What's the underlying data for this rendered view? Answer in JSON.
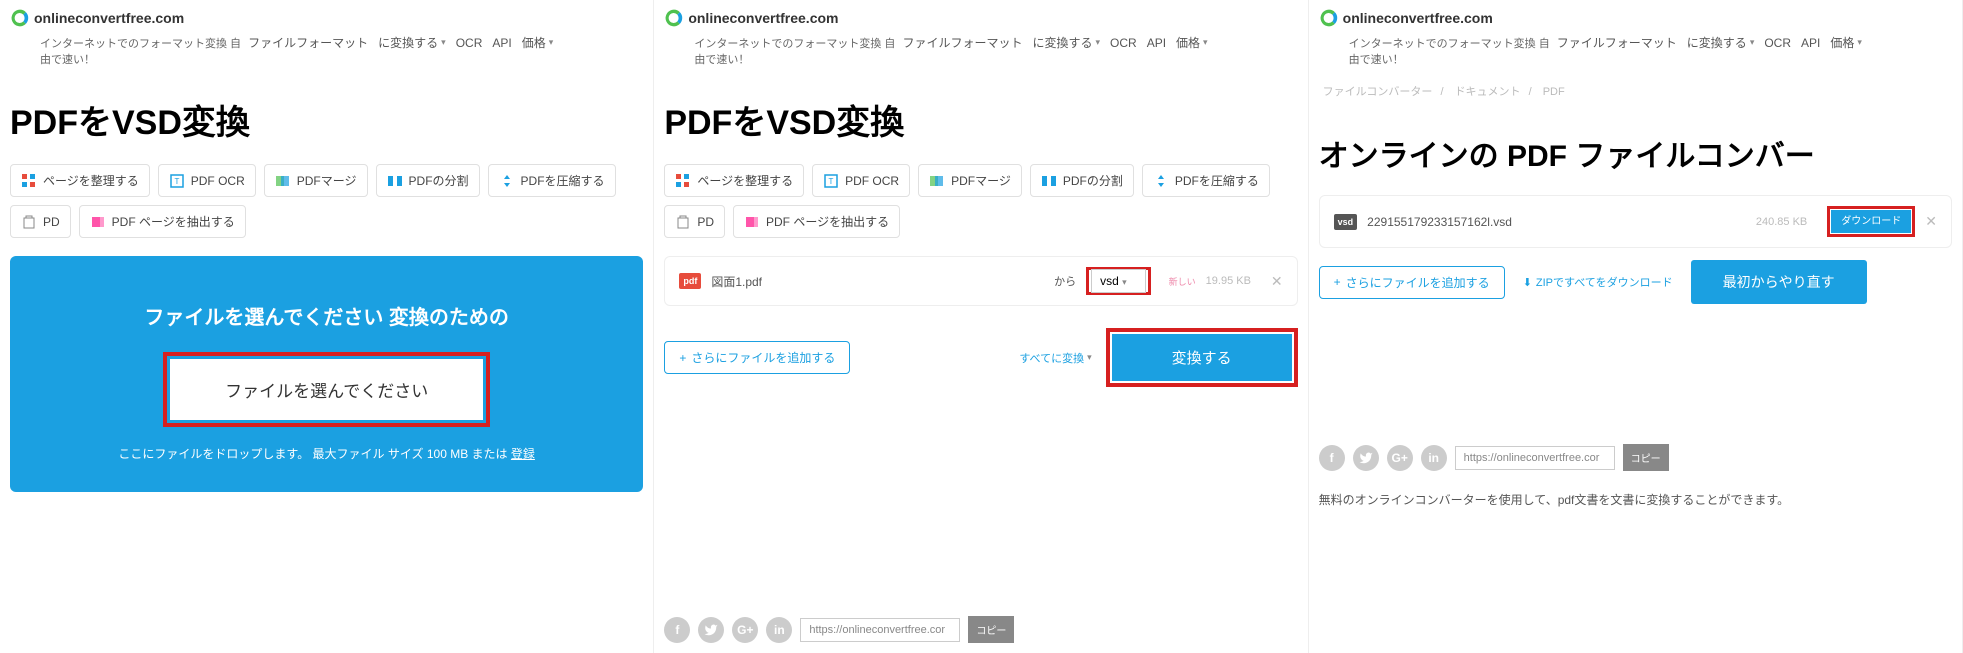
{
  "site": {
    "name": "onlineconvertfree.com",
    "tagline_prefix": "インターネットでのフォーマット変換 自",
    "tagline_suffix": "由で速い！"
  },
  "nav": {
    "file_format": "ファイルフォーマット",
    "convert_to": "に変換する",
    "ocr": "OCR",
    "api": "API",
    "price": "価格"
  },
  "p1": {
    "title": "PDFをVSD変換",
    "drop_title": "ファイルを選んでください 変換のための",
    "choose_btn": "ファイルを選んでください",
    "drop_sub_a": "ここにファイルをドロップします。 最大ファイル サイズ 100 MB または ",
    "drop_sub_b": "登録"
  },
  "p2": {
    "title": "PDFをVSD変換",
    "file_name": "図面1.pdf",
    "to": "から",
    "format": "vsd",
    "new": "新しい",
    "size": "19.95 KB",
    "add_more": "さらにファイルを追加する",
    "convert_all": "すべてに変換",
    "convert": "変換する"
  },
  "p3": {
    "breadcrumb": {
      "a": "ファイルコンバーター",
      "b": "ドキュメント",
      "c": "PDF"
    },
    "title": "オンラインの PDF ファイルコンバー",
    "file_name": "229155179233157162l.vsd",
    "size": "240.85 KB",
    "download": "ダウンロード",
    "add_more": "さらにファイルを追加する",
    "zip": "ZIPですべてをダウンロード",
    "restart": "最初からやり直す",
    "url": "https://onlineconvertfree.cor",
    "copy": "コピー",
    "desc": "無料のオンラインコンバーターを使用して、pdf文書を文書に変換することができます。"
  },
  "tools": {
    "organize": "ページを整理する",
    "ocr": "PDF OCR",
    "merge": "PDFマージ",
    "split": "PDFの分割",
    "compress": "PDFを圧縮する",
    "pd": "PD",
    "extract": "PDF ページを抽出する"
  },
  "social_url": "https://onlineconvertfree.cor",
  "social_copy": "コピー"
}
